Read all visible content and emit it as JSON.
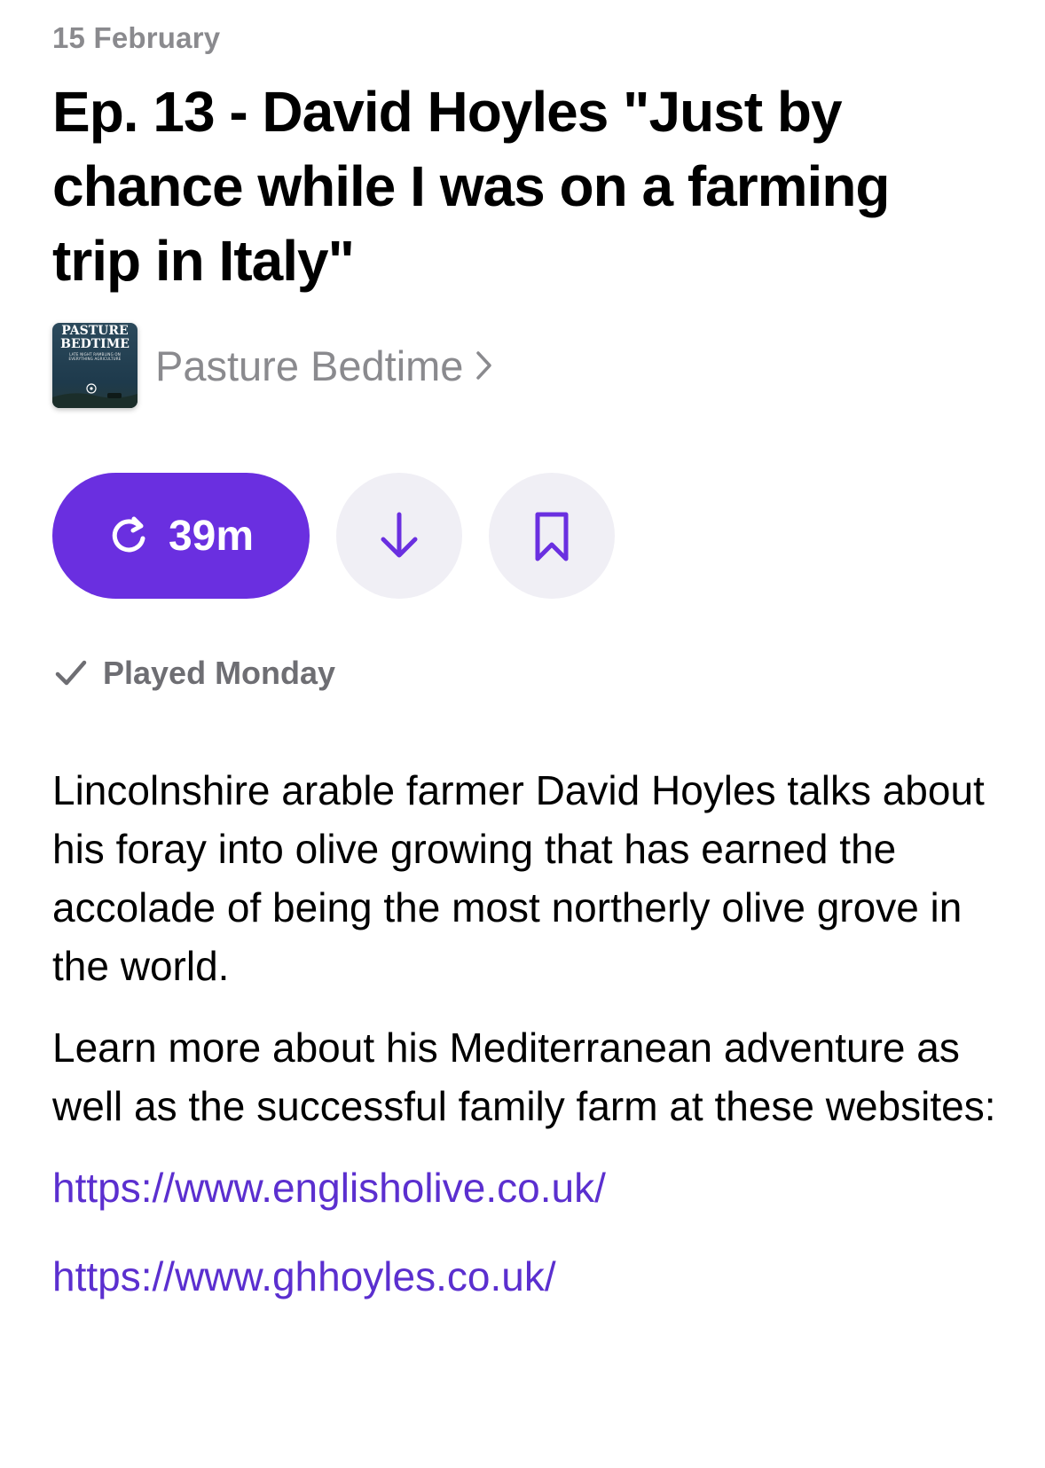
{
  "episode": {
    "date": "15 February",
    "title": "Ep. 13 - David Hoyles \"Just by chance while I was on a farming trip in Italy\""
  },
  "show": {
    "name": "Pasture Bedtime",
    "artwork_title": "PASTURE BEDTIME",
    "artwork_subtitle": "LATE NIGHT RAMBLING ON EVERYTHING AGRICULTURE",
    "chevron_icon": "chevron-right-icon"
  },
  "actions": {
    "play_label": "39m",
    "play_icon": "replay-icon",
    "download_icon": "download-arrow-icon",
    "save_icon": "bookmark-icon",
    "accent_color": "#6a2fe0"
  },
  "status": {
    "played_label": "Played Monday",
    "icon": "checkmark-icon"
  },
  "description": {
    "paragraph_1": "Lincolnshire arable farmer David Hoyles talks about his foray into olive growing that has earned the accolade of being the most northerly olive grove in the world.",
    "paragraph_2": "Learn more about his Mediterranean adventure as well as the successful family farm at these websites:",
    "links": [
      "https://www.englisholive.co.uk/",
      "https://www.ghhoyles.co.uk/"
    ]
  }
}
